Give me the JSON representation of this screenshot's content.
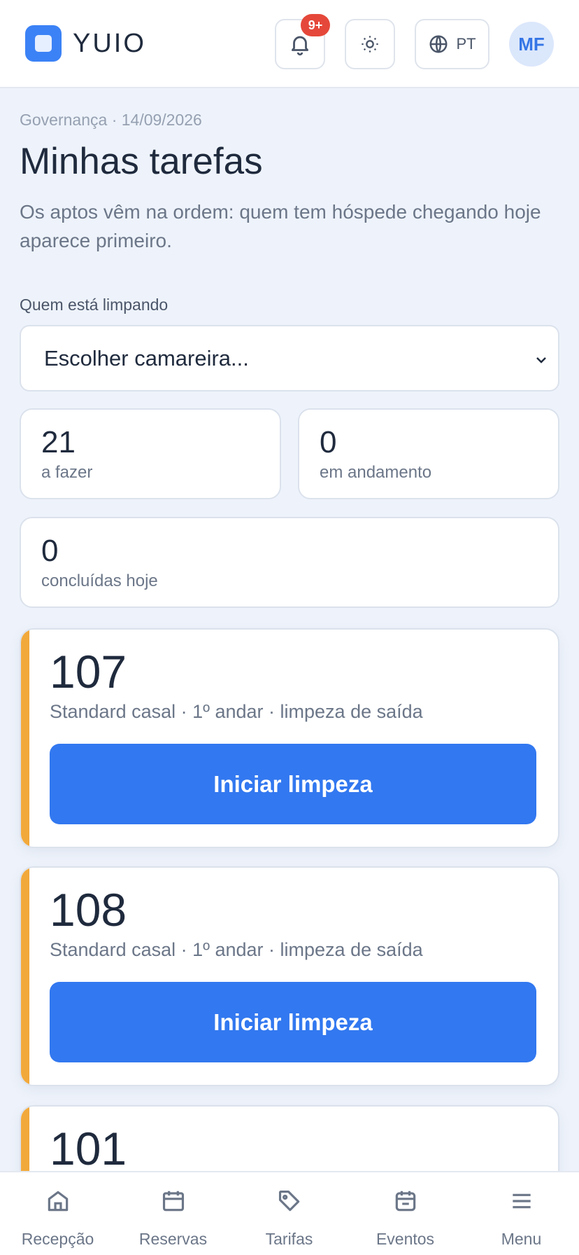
{
  "header": {
    "brand": "YUIO",
    "notifications_badge": "9+",
    "language": "PT",
    "avatar_initials": "MF"
  },
  "intro": {
    "breadcrumb": "Governança · 14/09/2026",
    "title": "Minhas tarefas",
    "subtitle": "Os aptos vêm na ordem: quem tem hóspede chegando hoje aparece primeiro."
  },
  "filter": {
    "label": "Quem está limpando",
    "selected": "Escolher camareira..."
  },
  "stats": [
    {
      "value": "21",
      "label": "a fazer"
    },
    {
      "value": "0",
      "label": "em andamento"
    },
    {
      "value": "0",
      "label": "concluídas hoje"
    }
  ],
  "tasks": [
    {
      "room": "107",
      "description": "Standard casal · 1º andar · limpeza de saída",
      "action": "Iniciar limpeza"
    },
    {
      "room": "108",
      "description": "Standard casal · 1º andar · limpeza de saída",
      "action": "Iniciar limpeza"
    },
    {
      "room": "101"
    }
  ],
  "nav": [
    {
      "label": "Recepção",
      "icon": "home-icon"
    },
    {
      "label": "Reservas",
      "icon": "calendar-icon"
    },
    {
      "label": "Tarifas",
      "icon": "tag-icon"
    },
    {
      "label": "Eventos",
      "icon": "event-calendar-icon"
    },
    {
      "label": "Menu",
      "icon": "menu-icon"
    }
  ],
  "colors": {
    "accent": "#3278f0",
    "pending_bar": "#f2a93b",
    "badge": "#e5483a",
    "background": "#eef3fb"
  }
}
